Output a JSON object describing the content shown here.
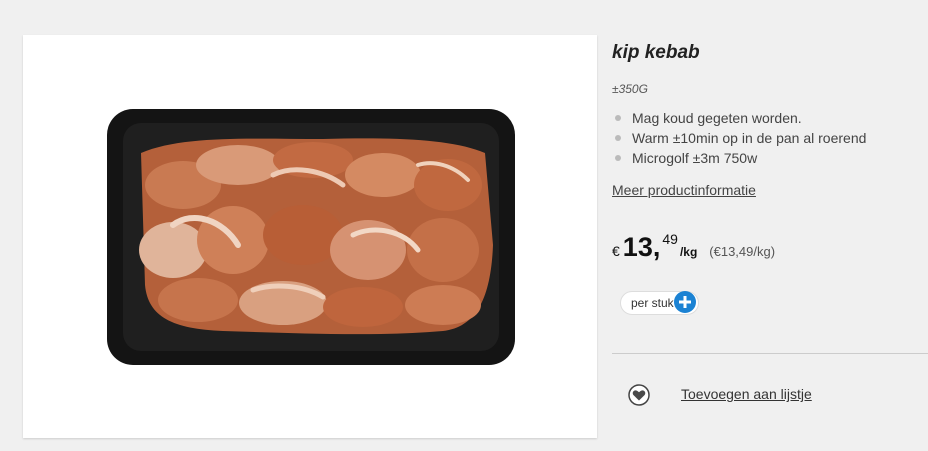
{
  "product": {
    "image_alt": "kip kebab in zwarte bak",
    "title": "kip kebab",
    "weight": "±350G",
    "features": [
      "Mag koud gegeten worden.",
      "Warm ±10min op in de pan al roerend",
      "Microgolf ±3m 750w"
    ],
    "more_info_link": "Meer productinformatie"
  },
  "price": {
    "currency": "€",
    "integer": "13",
    "separator": ",",
    "fraction": "49",
    "unit": "/kg",
    "per_kg": "(€13,49/kg)"
  },
  "order": {
    "unit_select_value": "per stuk",
    "add_icon": "plus-circle-icon"
  },
  "wishlist": {
    "icon": "heart-icon",
    "label": "Toevoegen aan lijstje"
  },
  "colors": {
    "accent": "#1b82d3",
    "background": "#f0f0f0",
    "tray": "#141414",
    "meat": "#c8704a"
  }
}
